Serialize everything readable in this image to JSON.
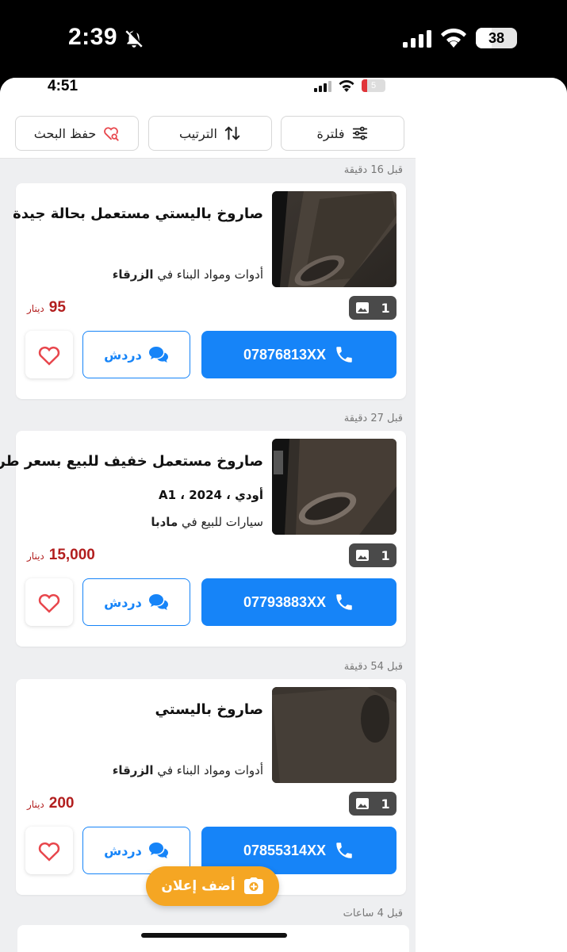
{
  "outer_status": {
    "time": "2:39",
    "battery": "38"
  },
  "inner_status": {
    "time": "4:51",
    "battery": "5"
  },
  "toolbar": {
    "filter_label": "فلترة",
    "sort_label": "الترتيب",
    "save_search_label": "حفظ البحث"
  },
  "listings": [
    {
      "time_ago": "قبل 16 دقيقة",
      "title": "صاروخ باليستي مستعمل بحالة جيدة",
      "meta": "",
      "category": "أدوات ومواد البناء في",
      "city": "الزرقاء",
      "image_count": "1",
      "price": "95",
      "currency": "دينار",
      "phone": "07876813XX",
      "chat_label": "دردش"
    },
    {
      "time_ago": "قبل 27 دقيقة",
      "title": "صاروخ مستعمل خفيف للبيع بسعر طري",
      "meta": "أودي ، A1 ، 2024",
      "category": "سيارات للبيع في",
      "city": "مادبا",
      "image_count": "1",
      "price": "15,000",
      "currency": "دينار",
      "phone": "07793883XX",
      "chat_label": "دردش"
    },
    {
      "time_ago": "قبل 54 دقيقة",
      "title": "صاروخ باليستي",
      "meta": "",
      "category": "أدوات ومواد البناء في",
      "city": "الزرقاء",
      "image_count": "1",
      "price": "200",
      "currency": "دينار",
      "phone": "07855314XX",
      "chat_label": "دردش"
    },
    {
      "time_ago": "قبل 4 ساعات"
    }
  ],
  "add_listing_label": "أضف إعلان",
  "colors": {
    "primary": "#1684f8",
    "price": "#b21e1e",
    "fab": "#f5a623",
    "heart": "#e8474d"
  }
}
